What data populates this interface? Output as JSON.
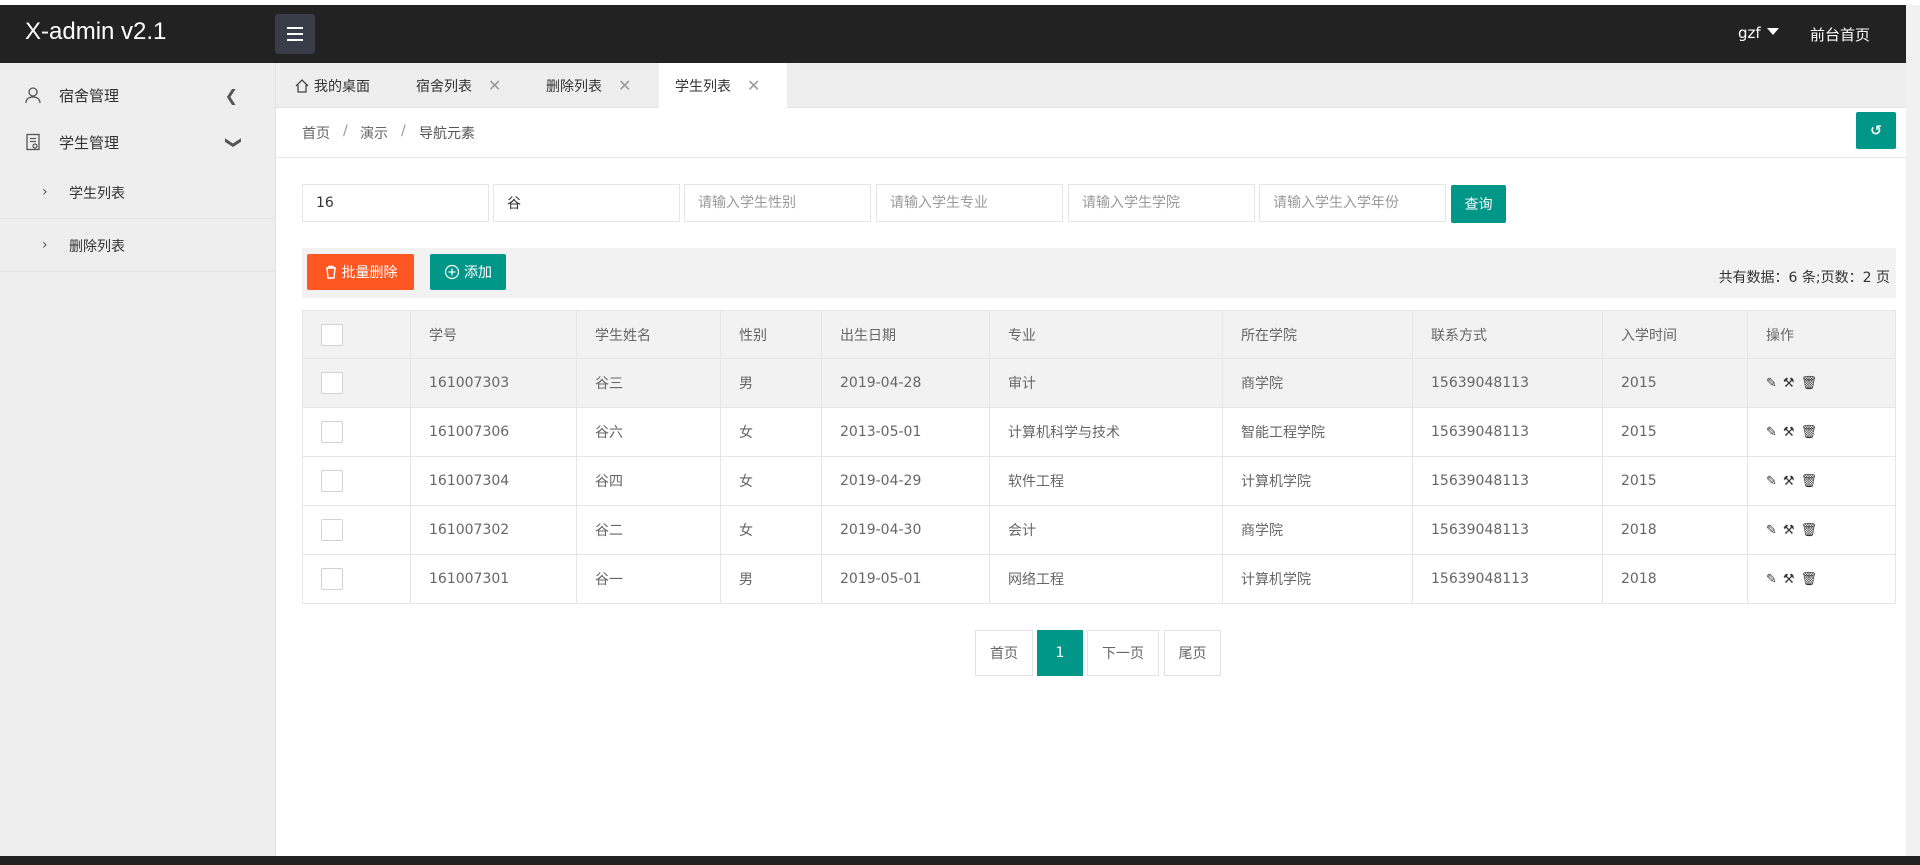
{
  "app": {
    "title": "X-admin v2.1"
  },
  "header": {
    "user": "gzf",
    "front_link": "前台首页"
  },
  "sidebar": {
    "items": [
      {
        "label": "宿舍管理",
        "icon": "user-icon",
        "arrow": "<"
      },
      {
        "label": "学生管理",
        "icon": "document-icon",
        "arrow": "v"
      }
    ],
    "subitems": [
      {
        "label": "学生列表"
      },
      {
        "label": "删除列表"
      }
    ]
  },
  "tabs": [
    {
      "label": "我的桌面",
      "icon": "home-icon",
      "closable": false
    },
    {
      "label": "宿舍列表",
      "closable": true
    },
    {
      "label": "删除列表",
      "closable": true
    },
    {
      "label": "学生列表",
      "closable": true,
      "active": true
    }
  ],
  "breadcrumb": [
    "首页",
    "演示",
    "导航元素"
  ],
  "search": {
    "fields": [
      {
        "value": "16",
        "placeholder": ""
      },
      {
        "value": "谷",
        "placeholder": ""
      },
      {
        "value": "",
        "placeholder": "请输入学生性别"
      },
      {
        "value": "",
        "placeholder": "请输入学生专业"
      },
      {
        "value": "",
        "placeholder": "请输入学生学院"
      },
      {
        "value": "",
        "placeholder": "请输入学生入学年份"
      }
    ],
    "query_label": "查询"
  },
  "toolbar": {
    "batch_delete_label": "批量删除",
    "add_label": "添加",
    "total_text": "共有数据：6 条;页数：2 页"
  },
  "table": {
    "columns": [
      "学号",
      "学生姓名",
      "性别",
      "出生日期",
      "专业",
      "所在学院",
      "联系方式",
      "入学时间",
      "操作"
    ],
    "rows": [
      [
        "161007303",
        "谷三",
        "男",
        "2019-04-28",
        "审计",
        "商学院",
        "15639048113",
        "2015"
      ],
      [
        "161007306",
        "谷六",
        "女",
        "2013-05-01",
        "计算机科学与技术",
        "智能工程学院",
        "15639048113",
        "2015"
      ],
      [
        "161007304",
        "谷四",
        "女",
        "2019-04-29",
        "软件工程",
        "计算机学院",
        "15639048113",
        "2015"
      ],
      [
        "161007302",
        "谷二",
        "女",
        "2019-04-30",
        "会计",
        "商学院",
        "15639048113",
        "2018"
      ],
      [
        "161007301",
        "谷一",
        "男",
        "2019-05-01",
        "网络工程",
        "计算机学院",
        "15639048113",
        "2018"
      ]
    ]
  },
  "pager": {
    "first": "首页",
    "current": "1",
    "next": "下一页",
    "last": "尾页"
  },
  "colors": {
    "accent": "#009688",
    "danger": "#FF5722",
    "header_bg": "#222222",
    "sidebar_bg": "#EEEEEE"
  }
}
